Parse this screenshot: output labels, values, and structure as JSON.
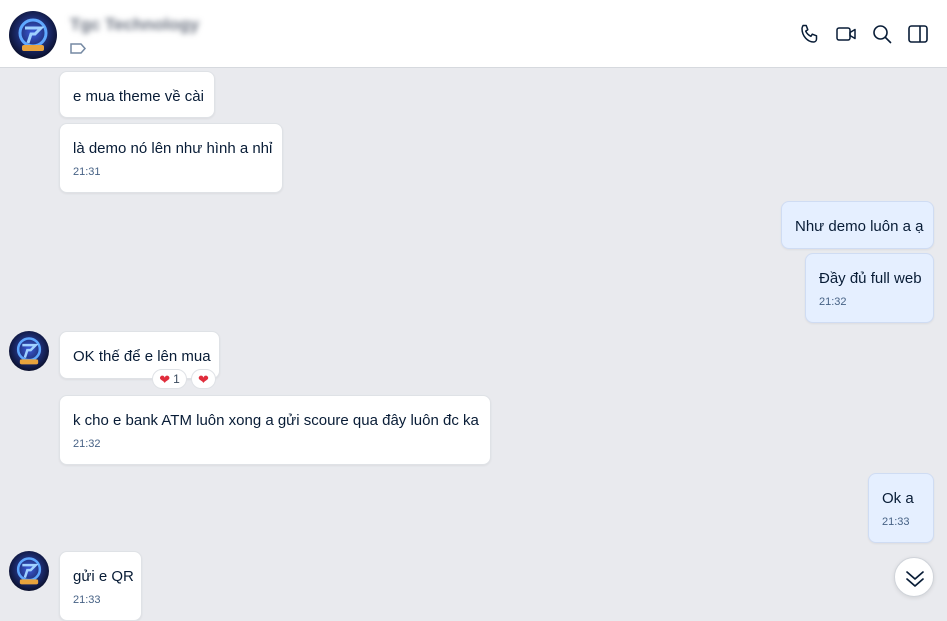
{
  "header": {
    "contact_name": "Tgc Technology",
    "actions": [
      {
        "name": "call-icon",
        "label": "Call"
      },
      {
        "name": "video-call-icon",
        "label": "Video call"
      },
      {
        "name": "search-icon",
        "label": "Search"
      },
      {
        "name": "sidebar-toggle-icon",
        "label": "Toggle conversation info"
      }
    ]
  },
  "messages": [
    {
      "sender": "contact",
      "text": "e mua theme về cài",
      "time": ""
    },
    {
      "sender": "contact",
      "text": "là demo nó lên như hình a nhỉ",
      "time": "21:31"
    },
    {
      "sender": "me",
      "text": "Như demo luôn a ạ",
      "time": ""
    },
    {
      "sender": "me",
      "text": "Đầy đủ full web",
      "time": "21:32"
    },
    {
      "sender": "contact",
      "text": "OK thế để e lên mua",
      "time": "",
      "reactions": {
        "count": "1",
        "icon": "heart-icon"
      }
    },
    {
      "sender": "contact",
      "text": "k cho e bank ATM luôn xong a gửi scoure qua đây luôn đc ka",
      "time": "21:32"
    },
    {
      "sender": "me",
      "text": "Ok a",
      "time": "21:33"
    },
    {
      "sender": "contact",
      "text": "gửi e QR",
      "time": "21:33"
    }
  ],
  "colors": {
    "background": "#e9eaee",
    "incoming_bubble": "#ffffff",
    "outgoing_bubble": "#e5efff",
    "text": "#081c36",
    "time": "#476285",
    "reaction_heart": "#e02d3c"
  }
}
